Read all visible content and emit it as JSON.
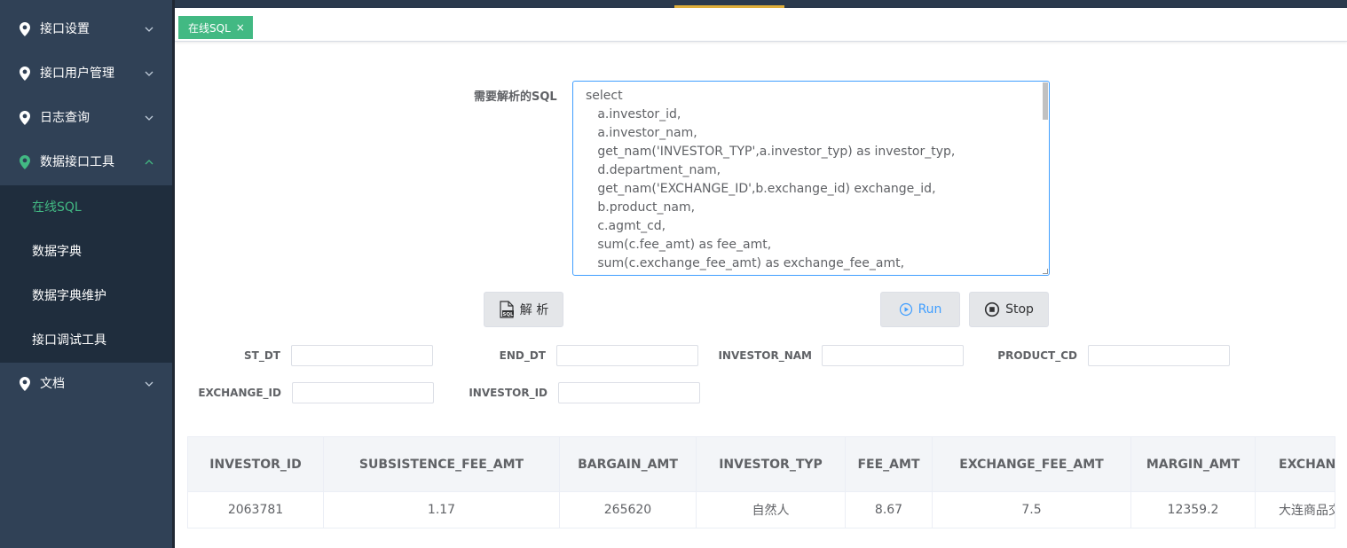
{
  "sidebar": {
    "menu": [
      {
        "label": "接口设置",
        "expanded": false
      },
      {
        "label": "接口用户管理",
        "expanded": false
      },
      {
        "label": "日志查询",
        "expanded": false
      },
      {
        "label": "数据接口工具",
        "expanded": true
      },
      {
        "label": "文档",
        "expanded": false
      }
    ],
    "submenu": [
      {
        "label": "在线SQL",
        "current": true
      },
      {
        "label": "数据字典"
      },
      {
        "label": "数据字典维护"
      },
      {
        "label": "接口调试工具"
      }
    ]
  },
  "tabs": [
    {
      "label": "在线SQL",
      "close": "×"
    }
  ],
  "sql": {
    "label": "需要解析的SQL",
    "lines": [
      "select ",
      "   a.investor_id,",
      "   a.investor_nam,",
      "   get_nam('INVESTOR_TYP',a.investor_typ) as investor_typ,",
      "   d.department_nam,",
      "   get_nam('EXCHANGE_ID',b.exchange_id) exchange_id,",
      "   b.product_nam,",
      "   c.agmt_cd,",
      "   sum(c.fee_amt) as fee_amt,",
      "   sum(c.exchange_fee_amt) as exchange_fee_amt,"
    ]
  },
  "buttons": {
    "parse": "解 析",
    "run": "Run",
    "stop": "Stop"
  },
  "params": [
    {
      "label": "ST_DT",
      "value": ""
    },
    {
      "label": "END_DT",
      "value": ""
    },
    {
      "label": "INVESTOR_NAM",
      "value": ""
    },
    {
      "label": "PRODUCT_CD",
      "value": ""
    },
    {
      "label": "EXCHANGE_ID",
      "value": ""
    },
    {
      "label": "INVESTOR_ID",
      "value": ""
    }
  ],
  "table": {
    "columns": [
      "INVESTOR_ID",
      "SUBSISTENCE_FEE_AMT",
      "BARGAIN_AMT",
      "INVESTOR_TYP",
      "FEE_AMT",
      "EXCHANGE_FEE_AMT",
      "MARGIN_AMT",
      "EXCHANGE_ID"
    ],
    "rows": [
      [
        "2063781",
        "1.17",
        "265620",
        "自然人",
        "8.67",
        "7.5",
        "12359.2",
        "大连商品交易所"
      ]
    ]
  },
  "colors": {
    "sidebar_bg": "#304156",
    "submenu_bg": "#1f2d3d",
    "accent_green": "#42b983",
    "run_blue": "#409eff"
  }
}
